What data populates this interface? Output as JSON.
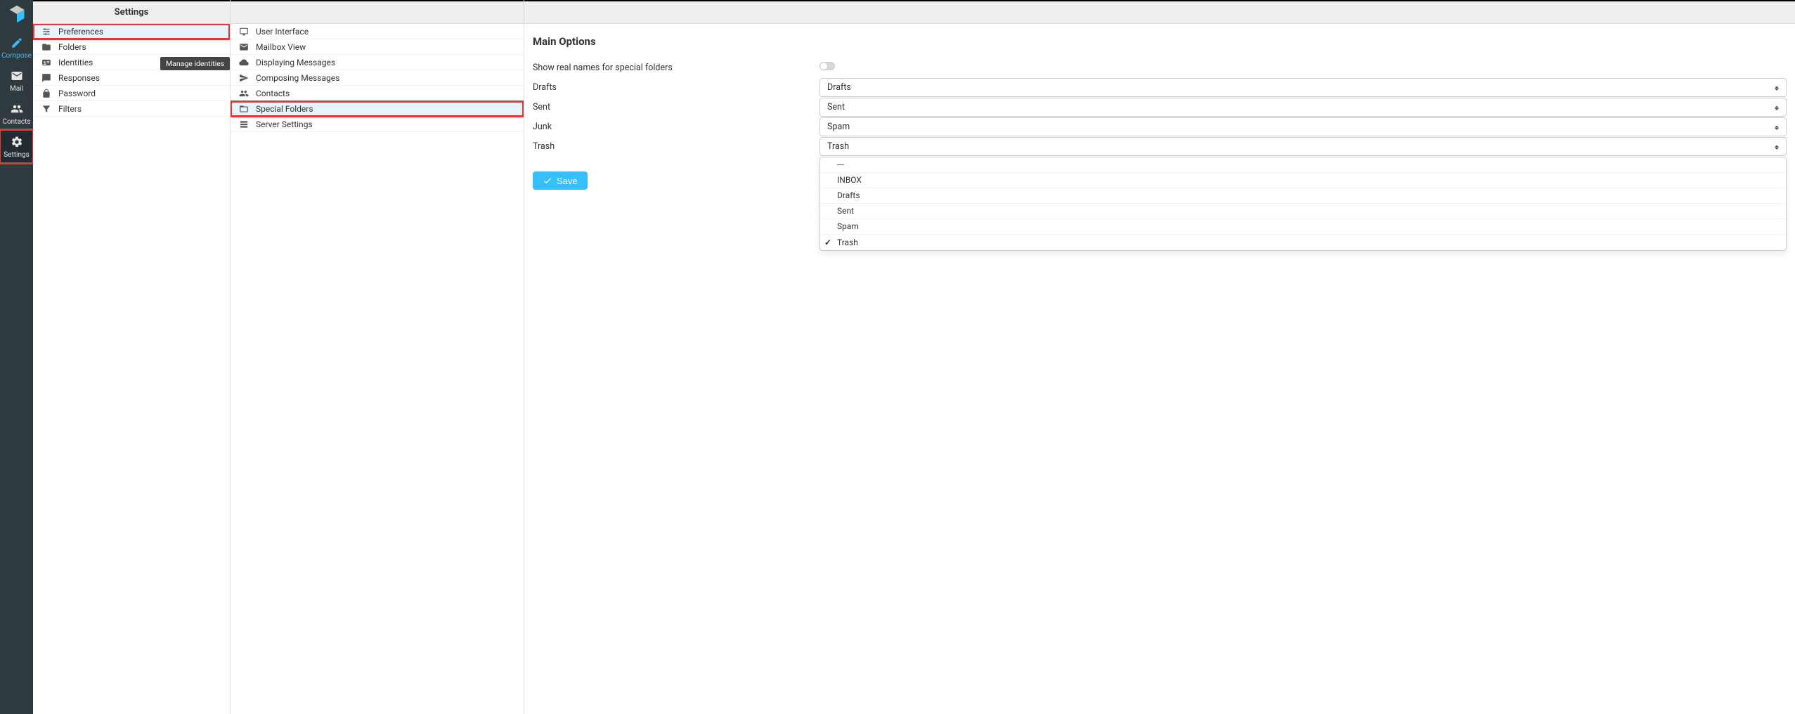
{
  "taskbar": {
    "compose": "Compose",
    "mail": "Mail",
    "contacts": "Contacts",
    "settings": "Settings"
  },
  "settings_col": {
    "header": "Settings",
    "items": [
      {
        "label": "Preferences",
        "icon": "sliders"
      },
      {
        "label": "Folders",
        "icon": "folder"
      },
      {
        "label": "Identities",
        "icon": "id-card"
      },
      {
        "label": "Responses",
        "icon": "comment"
      },
      {
        "label": "Password",
        "icon": "lock"
      },
      {
        "label": "Filters",
        "icon": "filter"
      }
    ],
    "tooltip": "Manage identities"
  },
  "prefs_col": {
    "items": [
      {
        "label": "User Interface",
        "icon": "monitor"
      },
      {
        "label": "Mailbox View",
        "icon": "envelope"
      },
      {
        "label": "Displaying Messages",
        "icon": "cloud-down"
      },
      {
        "label": "Composing Messages",
        "icon": "paper-plane"
      },
      {
        "label": "Contacts",
        "icon": "users"
      },
      {
        "label": "Special Folders",
        "icon": "folder-open"
      },
      {
        "label": "Server Settings",
        "icon": "server"
      }
    ]
  },
  "main": {
    "section_title": "Main Options",
    "toggle_label": "Show real names for special folders",
    "rows": [
      {
        "label": "Drafts",
        "value": "Drafts"
      },
      {
        "label": "Sent",
        "value": "Sent"
      },
      {
        "label": "Junk",
        "value": "Spam"
      },
      {
        "label": "Trash",
        "value": "Trash"
      }
    ],
    "dropdown_options": [
      {
        "label": "---",
        "checked": false
      },
      {
        "label": "INBOX",
        "checked": false
      },
      {
        "label": "Drafts",
        "checked": false
      },
      {
        "label": "Sent",
        "checked": false
      },
      {
        "label": "Spam",
        "checked": false
      },
      {
        "label": "Trash",
        "checked": true
      }
    ],
    "save_label": "Save"
  }
}
